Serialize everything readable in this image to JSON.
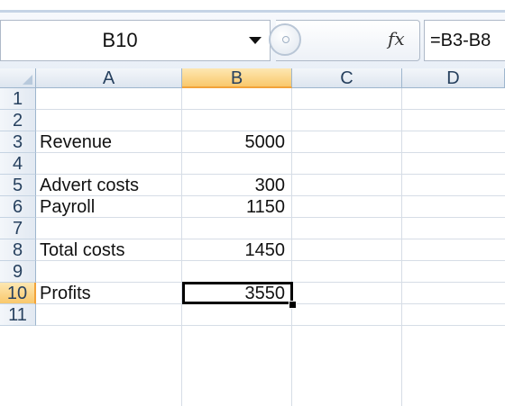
{
  "formula_bar": {
    "name_box": "B10",
    "fx_label": "fx",
    "formula": "=B3-B8"
  },
  "columns": [
    "A",
    "B",
    "C",
    "D"
  ],
  "active_column": "B",
  "rows": [
    {
      "num": "1",
      "a": "",
      "b": ""
    },
    {
      "num": "2",
      "a": "",
      "b": ""
    },
    {
      "num": "3",
      "a": "Revenue",
      "b": "5000"
    },
    {
      "num": "4",
      "a": "",
      "b": ""
    },
    {
      "num": "5",
      "a": "Advert costs",
      "b": "300"
    },
    {
      "num": "6",
      "a": "Payroll",
      "b": "1150"
    },
    {
      "num": "7",
      "a": "",
      "b": ""
    },
    {
      "num": "8",
      "a": "Total costs",
      "b": "1450"
    },
    {
      "num": "9",
      "a": "",
      "b": ""
    },
    {
      "num": "10",
      "a": "Profits",
      "b": "3550"
    },
    {
      "num": "11",
      "a": "",
      "b": ""
    }
  ],
  "active_row": "10",
  "icons": {
    "dropdown": "dropdown-arrow-icon",
    "function": "insert-function-icon",
    "select_all": "select-all-triangle-icon"
  }
}
